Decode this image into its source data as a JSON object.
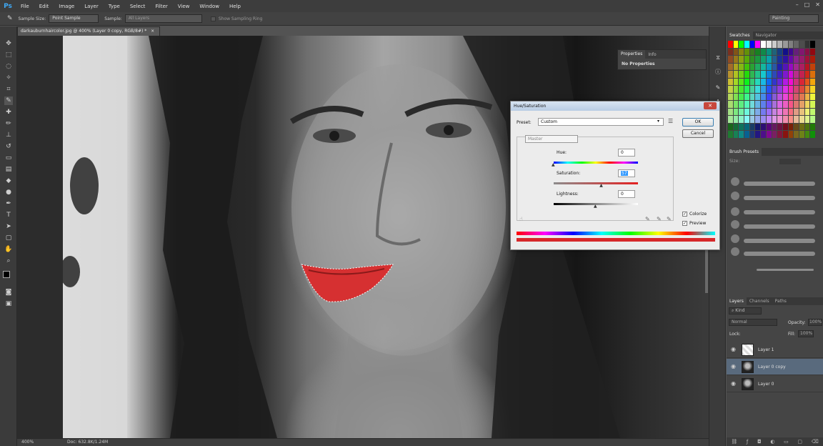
{
  "app": {
    "logo": "Ps"
  },
  "menu": [
    "File",
    "Edit",
    "Image",
    "Layer",
    "Type",
    "Select",
    "Filter",
    "View",
    "Window",
    "Help"
  ],
  "window_controls": [
    "–",
    "□",
    "✕"
  ],
  "options_bar": {
    "sample_size_label": "Sample Size:",
    "sample_size_value": "Point Sample",
    "sample_label": "Sample:",
    "sample_value": "All Layers",
    "sampling_ring_label": "Show Sampling Ring",
    "workspace": "Painting"
  },
  "document": {
    "tab_title": "darkauburnhaircolor.jpg @ 400% (Layer 0 copy, RGB/8#) *",
    "tab_close": "×"
  },
  "status": {
    "zoom": "400%",
    "doc_info": "Doc: 632.8K/1.24M"
  },
  "properties": {
    "tab_properties": "Properties",
    "tab_info": "Info",
    "content": "No Properties"
  },
  "swatches": {
    "tab_swatches": "Swatches",
    "tab_navigator": "Navigator",
    "colors": [
      "#ff0000",
      "#ffff00",
      "#00ff00",
      "#00ffff",
      "#0000ff",
      "#ff00ff",
      "#ffffff",
      "#e6e6e6",
      "#cccccc",
      "#b3b3b3",
      "#999999",
      "#808080",
      "#666666",
      "#4d4d4d",
      "#333333",
      "#000000"
    ]
  },
  "brush_presets": {
    "tab": "Brush Presets",
    "size_label": "Size:"
  },
  "layers": {
    "tab_layers": "Layers",
    "tab_channels": "Channels",
    "tab_paths": "Paths",
    "kind_label": "Kind",
    "blend_mode": "Normal",
    "opacity_label": "Opacity:",
    "opacity_value": "100%",
    "lock_label": "Lock:",
    "fill_label": "Fill:",
    "fill_value": "100%",
    "items": [
      {
        "name": "Layer 1"
      },
      {
        "name": "Layer 0 copy"
      },
      {
        "name": "Layer 0"
      }
    ]
  },
  "hue_dialog": {
    "title": "Hue/Saturation",
    "close": "✕",
    "preset_label": "Preset:",
    "preset_value": "Custom",
    "channel": "Master",
    "hue_label": "Hue:",
    "hue_value": "0",
    "saturation_label": "Saturation:",
    "saturation_value": "57",
    "saturation_level": 0.57,
    "lightness_label": "Lightness:",
    "lightness_value": "0",
    "ok": "OK",
    "cancel": "Cancel",
    "colorize_label": "Colorize",
    "preview_label": "Preview",
    "colorize_checked": true,
    "preview_checked": true
  }
}
